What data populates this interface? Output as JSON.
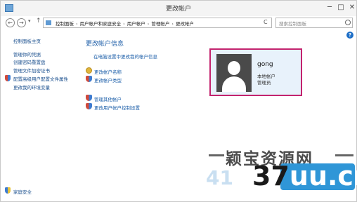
{
  "window": {
    "title": "更改帐户",
    "min": "─",
    "max": "□",
    "close": "✕"
  },
  "nav": {
    "back": "←",
    "forward": "→",
    "dropdown": "▾",
    "up": "↑",
    "refresh": "C",
    "address_dropdown": "▾",
    "breadcrumbs": [
      "控制面板",
      "用户帐户和家庭安全",
      "用户帐户",
      "管理帐户",
      "更改帐户"
    ],
    "separator": "›",
    "search_placeholder": "搜索控制面板"
  },
  "help_label": "?",
  "sidebar": {
    "items": [
      "控制面板主页",
      "管理你的凭据",
      "创建密码重置盘",
      "管理文件加密证书",
      "配置高级用户配置文件属性",
      "更改我的环境变量"
    ],
    "bottom": "家庭安全"
  },
  "main": {
    "title": "更改帐户信息",
    "settings_link": "在电脑设置中更改我的帐户信息",
    "actions": [
      "更改帐户名称",
      "更改帐户类型"
    ],
    "actions2": [
      "管理其他帐户",
      "更改用户帐户控制设置"
    ]
  },
  "account": {
    "name": "gong",
    "type": "本地帐户",
    "role": "管理员"
  },
  "watermark": {
    "site_name": "颖宝资源网",
    "dashes_left": "--",
    "dashes_right": "--",
    "url_prefix": "41",
    "url_main": "37",
    "url_suffix": "uu.cn"
  }
}
